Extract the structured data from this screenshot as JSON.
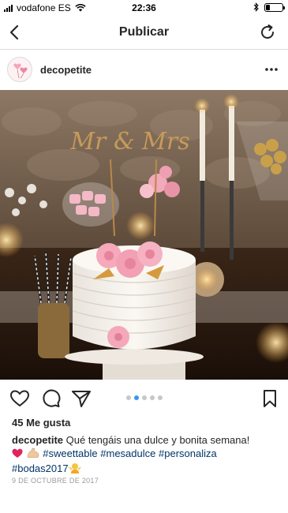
{
  "status_bar": {
    "carrier": "vodafone ES",
    "time": "22:36",
    "battery_level": 0.25
  },
  "nav": {
    "title": "Publicar",
    "back_icon": "chevron-left-icon",
    "refresh_icon": "refresh-icon"
  },
  "post": {
    "username": "decopetite",
    "more_icon": "more-horizontal-icon",
    "likes": "45 Me gusta",
    "caption": {
      "username": "decopetite",
      "text": "Qué tengáis una dulce y bonita semana!",
      "hashtags": [
        "#sweettable",
        "#mesadulce",
        "#personaliza",
        "#bodas2017"
      ]
    },
    "date": "9 DE OCTUBRE DE 2017",
    "carousel": {
      "count": 5,
      "active_index": 1
    },
    "photo_topper_text": "Mr & Mrs"
  },
  "colors": {
    "accent": "#3897f0",
    "hashtag": "#003569",
    "meta": "#999999",
    "text": "#262626"
  }
}
